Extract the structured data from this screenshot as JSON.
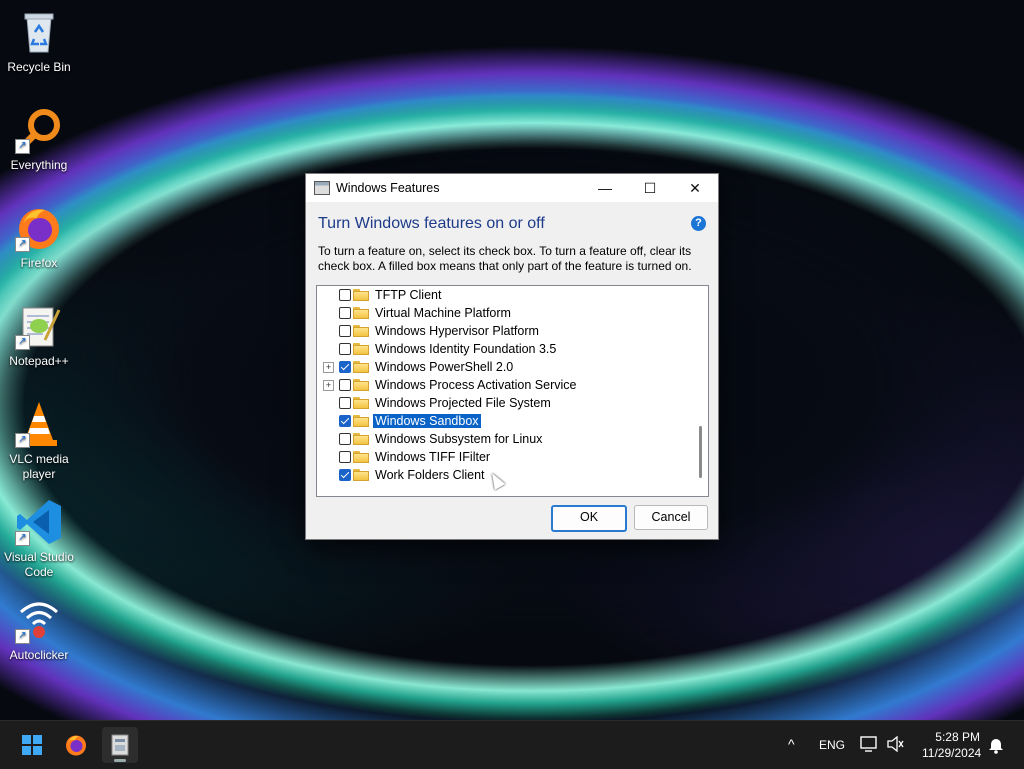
{
  "desktop": {
    "icons": [
      {
        "label": "Recycle Bin",
        "icon": "recycle-bin-icon"
      },
      {
        "label": "Everything",
        "icon": "search-magnifier-icon"
      },
      {
        "label": "Firefox",
        "icon": "firefox-icon"
      },
      {
        "label": "Notepad++",
        "icon": "notepad-plus-plus-icon"
      },
      {
        "label": "VLC media player",
        "icon": "vlc-cone-icon"
      },
      {
        "label": "Visual Studio Code",
        "icon": "vscode-icon"
      },
      {
        "label": "Autoclicker",
        "icon": "autoclicker-icon"
      }
    ]
  },
  "dialog": {
    "title": "Windows Features",
    "heading": "Turn Windows features on or off",
    "description": "To turn a feature on, select its check box. To turn a feature off, clear its check box. A filled box means that only part of the feature is turned on.",
    "features": [
      {
        "label": "TFTP Client",
        "checked": false,
        "expandable": false,
        "selected": false
      },
      {
        "label": "Virtual Machine Platform",
        "checked": false,
        "expandable": false,
        "selected": false
      },
      {
        "label": "Windows Hypervisor Platform",
        "checked": false,
        "expandable": false,
        "selected": false
      },
      {
        "label": "Windows Identity Foundation 3.5",
        "checked": false,
        "expandable": false,
        "selected": false
      },
      {
        "label": "Windows PowerShell 2.0",
        "checked": true,
        "expandable": true,
        "selected": false
      },
      {
        "label": "Windows Process Activation Service",
        "checked": false,
        "expandable": true,
        "selected": false
      },
      {
        "label": "Windows Projected File System",
        "checked": false,
        "expandable": false,
        "selected": false
      },
      {
        "label": "Windows Sandbox",
        "checked": true,
        "expandable": false,
        "selected": true
      },
      {
        "label": "Windows Subsystem for Linux",
        "checked": false,
        "expandable": false,
        "selected": false
      },
      {
        "label": "Windows TIFF IFilter",
        "checked": false,
        "expandable": false,
        "selected": false
      },
      {
        "label": "Work Folders Client",
        "checked": true,
        "expandable": false,
        "selected": false
      }
    ],
    "ok_label": "OK",
    "cancel_label": "Cancel",
    "minimize_glyph": "—",
    "maximize_glyph": "☐",
    "close_glyph": "✕",
    "help_glyph": "?",
    "expander_glyph": "+"
  },
  "taskbar": {
    "language": "ENG",
    "time": "5:28 PM",
    "date": "11/29/2024",
    "chevron_glyph": "^",
    "apps": [
      {
        "name": "start",
        "icon": "windows-start-icon"
      },
      {
        "name": "firefox",
        "icon": "firefox-icon"
      },
      {
        "name": "windows-features",
        "icon": "windows-features-app-icon",
        "active": true
      }
    ]
  },
  "colors": {
    "accent": "#0a64c8",
    "heading": "#1e3b8a",
    "taskbar": "#1c1c1c"
  }
}
